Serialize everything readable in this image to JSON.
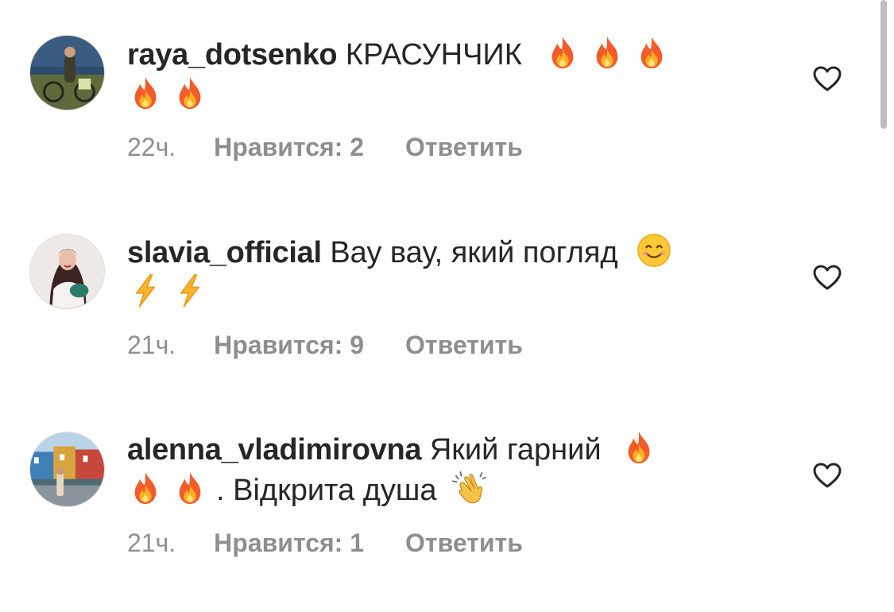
{
  "comments": [
    {
      "username": "raya_dotsenko",
      "text": "КРАСУНЧИК",
      "emoji_icons": [
        "fire-icon",
        "fire-icon",
        "fire-icon",
        "fire-icon",
        "fire-icon"
      ],
      "time": "22ч.",
      "likes": "Нравится: 2",
      "reply": "Ответить"
    },
    {
      "username": "slavia_official",
      "text": "Вау вау, який погляд",
      "emoji_icons": [
        "smiling-face-icon",
        "lightning-icon",
        "lightning-icon"
      ],
      "time": "21ч.",
      "likes": "Нравится: 9",
      "reply": "Ответить"
    },
    {
      "username": "alenna_vladimirovna",
      "text": "Який гарний",
      "text_after_emojis": ". Відкрита душа",
      "emoji_icons": [
        "fire-icon",
        "fire-icon",
        "fire-icon",
        "clapping-hands-icon"
      ],
      "time": "21ч.",
      "likes": "Нравится: 1",
      "reply": "Ответить"
    }
  ],
  "colors": {
    "text": "#262626",
    "secondary": "#8e8e8e",
    "fire": "#f5572b",
    "lightning": "#f7b32b",
    "heart_outline": "#262626"
  }
}
